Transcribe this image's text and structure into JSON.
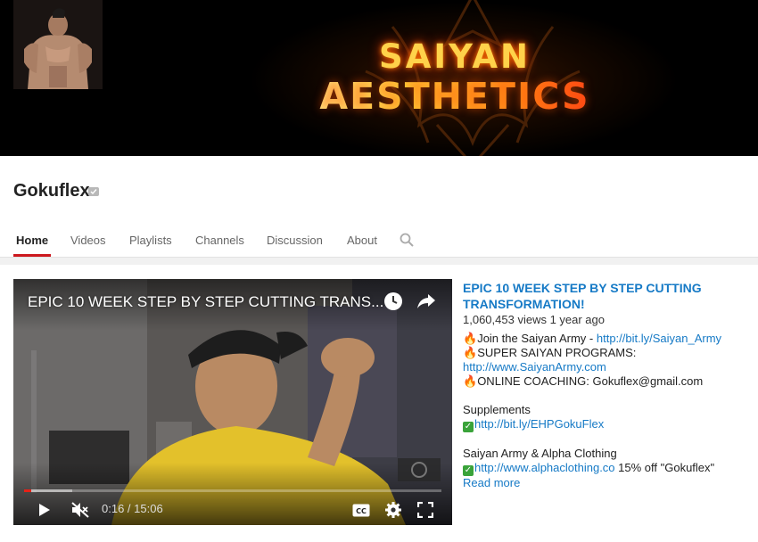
{
  "banner": {
    "title_line1": "SAIYAN",
    "title_line2": "AESTHETICS"
  },
  "channel": {
    "name": "Gokuflex",
    "verified_icon": "verified-badge-icon"
  },
  "tabs": [
    {
      "label": "Home",
      "active": true
    },
    {
      "label": "Videos",
      "active": false
    },
    {
      "label": "Playlists",
      "active": false
    },
    {
      "label": "Channels",
      "active": false
    },
    {
      "label": "Discussion",
      "active": false
    },
    {
      "label": "About",
      "active": false
    }
  ],
  "player": {
    "title": "EPIC 10 WEEK STEP BY STEP CUTTING TRANS...",
    "time": "0:16 / 15:06",
    "progress_fraction": 0.018,
    "buffered_fraction": 0.115,
    "icons": [
      "clock-icon",
      "share-icon",
      "play-icon",
      "mute-icon",
      "cc-icon",
      "gear-icon",
      "fullscreen-icon"
    ]
  },
  "video": {
    "title": "EPIC 10 WEEK STEP BY STEP CUTTING TRANSFORMATION!",
    "meta": "1,060,453 views  1 year ago",
    "line1_text": "Join the Saiyan Army - ",
    "line1_link": "http://bit.ly/Saiyan_Army",
    "line2_text": "SUPER SAIYAN PROGRAMS:",
    "line3_link": "http://www.SaiyanArmy.com",
    "line4_text": "ONLINE COACHING: Gokuflex@gmail.com",
    "supplements_heading": "Supplements",
    "supplements_link": "http://bit.ly/EHPGokuFlex",
    "clothing_heading": "Saiyan Army & Alpha Clothing",
    "clothing_link": "http://www.alphaclothing.co",
    "clothing_suffix": " 15% off \"Gokuflex\"",
    "read_more": "Read more"
  },
  "colors": {
    "accent_red": "#cc181e",
    "link_blue": "#167ac6",
    "progress_red": "#e62117"
  }
}
